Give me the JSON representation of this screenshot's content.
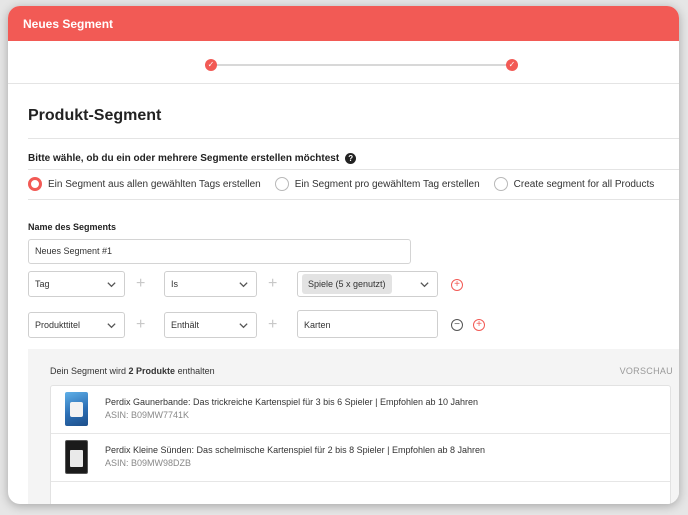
{
  "window": {
    "title": "Neues Segment"
  },
  "stepper": {
    "step1_icon": "check-icon",
    "step2_icon": "check-icon",
    "check_glyph": "✓"
  },
  "section": {
    "title": "Produkt-Segment"
  },
  "question": {
    "text": "Bitte wähle, ob du ein oder mehrere Segmente erstellen möchtest",
    "help_glyph": "?"
  },
  "radio_options": [
    {
      "label": "Ein Segment aus allen gewählten Tags erstellen",
      "selected": true
    },
    {
      "label": "Ein Segment pro gewähltem Tag erstellen",
      "selected": false
    },
    {
      "label": "Create segment for all Products",
      "selected": false
    }
  ],
  "segment_name": {
    "label": "Name des Segments",
    "value": "Neues Segment #1"
  },
  "rules": [
    {
      "field": "Tag",
      "operator": "Is",
      "value": "Spiele (5 x genutzt)"
    },
    {
      "field": "Produkttitel",
      "operator": "Enthält",
      "value": "Karten"
    }
  ],
  "preview": {
    "summary_prefix": "Dein Segment wird ",
    "summary_count": "2 Produkte",
    "summary_suffix": " enthalten",
    "link_label": "VORSCHAU",
    "products": [
      {
        "title": "Perdix Gaunerbande: Das trickreiche Kartenspiel für 3 bis 6 Spieler | Empfohlen ab 10 Jahren",
        "asin": "ASIN: B09MW7741K"
      },
      {
        "title": "Perdix Kleine Sünden: Das schelmische Kartenspiel für 2 bis 8 Spieler | Empfohlen ab 8 Jahren",
        "asin": "ASIN: B09MW98DZB"
      }
    ]
  },
  "glyphs": {
    "plus": "+",
    "add": "+",
    "remove": "−"
  },
  "colors": {
    "accent": "#f25a55",
    "text": "#222222",
    "muted": "#888888",
    "preview_bg": "#f4f4f4"
  }
}
